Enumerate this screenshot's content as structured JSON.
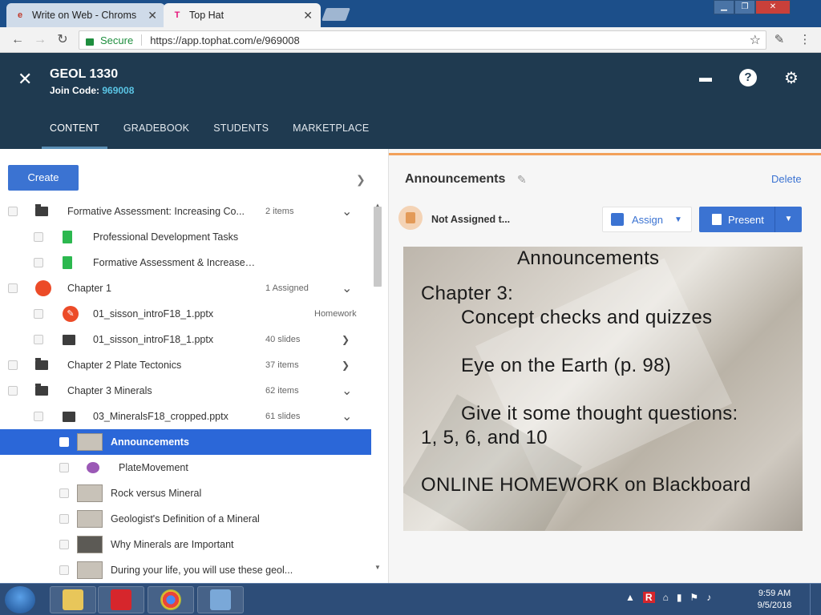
{
  "browser": {
    "tabs": [
      {
        "title": "Write on Web - Chroms",
        "favicon": "write-on-web-icon"
      },
      {
        "title": "Top Hat",
        "favicon": "tophat-icon"
      }
    ],
    "secure_label": "Secure",
    "url": "https://app.tophat.com/e/969008"
  },
  "app": {
    "course_title": "GEOL 1330",
    "join_label": "Join Code:",
    "join_code": "969008",
    "nav_tabs": [
      "CONTENT",
      "GRADEBOOK",
      "STUDENTS",
      "MARKETPLACE"
    ],
    "active_tab": "CONTENT",
    "create_label": "Create"
  },
  "tree": [
    {
      "label": "Formative Assessment: Increasing Co...",
      "meta": "2 items",
      "caret": "down",
      "icon": "folder-icon",
      "indent": 0
    },
    {
      "label": "Professional Development Tasks",
      "meta": "",
      "caret": "",
      "icon": "document-icon",
      "indent": 1
    },
    {
      "label": "Formative Assessment & Increased Compr...",
      "meta": "",
      "caret": "",
      "icon": "document-icon",
      "indent": 1
    },
    {
      "label": "Chapter 1",
      "meta": "1 Assigned",
      "caret": "down",
      "icon": "chapter-folder-icon",
      "indent": 0
    },
    {
      "label": "01_sisson_introF18_1.pptx",
      "meta": "Homework",
      "caret": "",
      "icon": "homework-icon",
      "indent": 1
    },
    {
      "label": "01_sisson_introF18_1.pptx",
      "meta": "40 slides",
      "caret": "right",
      "icon": "presentation-icon",
      "indent": 1
    },
    {
      "label": "Chapter 2 Plate Tectonics",
      "meta": "37 items",
      "caret": "right",
      "icon": "folder-icon",
      "indent": 0
    },
    {
      "label": "Chapter 3 Minerals",
      "meta": "62 items",
      "caret": "down",
      "icon": "folder-icon",
      "indent": 0
    },
    {
      "label": "03_MineralsF18_cropped.pptx",
      "meta": "61 slides",
      "caret": "down",
      "icon": "presentation-icon",
      "indent": 1
    },
    {
      "label": "Announcements",
      "meta": "",
      "caret": "",
      "icon": "slide-thumbnail-icon",
      "indent": 2,
      "selected": true
    },
    {
      "label": "PlateMovement",
      "meta": "",
      "caret": "",
      "icon": "discussion-icon",
      "indent": 2
    },
    {
      "label": "Rock versus Mineral",
      "meta": "",
      "caret": "",
      "icon": "slide-thumbnail-icon",
      "indent": 2
    },
    {
      "label": "Geologist's Definition of a Mineral",
      "meta": "",
      "caret": "",
      "icon": "slide-thumbnail-icon",
      "indent": 2
    },
    {
      "label": "Why Minerals are Important",
      "meta": "",
      "caret": "",
      "icon": "slide-thumbnail-icon",
      "indent": 2
    },
    {
      "label": "During your life, you will use these geol...",
      "meta": "",
      "caret": "",
      "icon": "slide-thumbnail-icon",
      "indent": 2
    }
  ],
  "detail": {
    "title": "Announcements",
    "delete_label": "Delete",
    "status": "Not Assigned t...",
    "assign_label": "Assign",
    "present_label": "Present",
    "slide_lines": [
      "Announcements",
      "Chapter 3:",
      "Concept checks and quizzes",
      "Eye on the Earth (p. 98)",
      "Give it some thought questions:",
      "1, 5, 6, and 10",
      "ONLINE HOMEWORK on Blackboard"
    ]
  },
  "taskbar": {
    "time": "9:59 AM",
    "date": "9/5/2018"
  },
  "colors": {
    "header_bg": "#1f3a50",
    "accent_blue": "#3b73d2",
    "join_code": "#5ac4e4",
    "selected_row": "#2b67d8",
    "chapter_red": "#ec4b28",
    "doc_green": "#2cb84f"
  }
}
